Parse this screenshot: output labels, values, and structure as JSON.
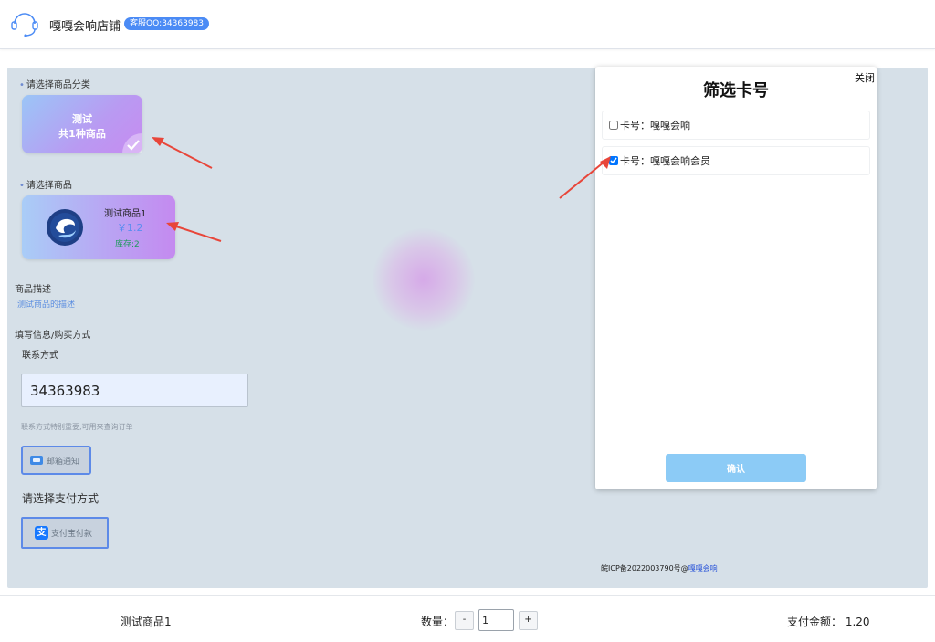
{
  "header": {
    "shop_name": "嘎嘎会响店铺",
    "qq_badge": "客服QQ:34363983"
  },
  "main": {
    "category_label": "请选择商品分类",
    "category_card": {
      "name": "测试",
      "count_text": "共1种商品"
    },
    "product_label": "请选择商品",
    "product_card": {
      "name": "测试商品1",
      "price": "￥1.2",
      "stock": "库存:2"
    },
    "description_title": "商品描述",
    "description_text": "测试商品的描述",
    "fill_title": "填写信息/购买方式",
    "contact_title": "联系方式",
    "contact_value": "34363983",
    "contact_tip": "联系方式特别重要,可用来查询订单",
    "email_button": "邮箱通知",
    "payment_title": "请选择支付方式",
    "alipay_button": "支付宝付款",
    "alipay_glyph": "支",
    "icp_text": "皖ICP备2022003790号@",
    "icp_link": "嘎嘎会响"
  },
  "modal": {
    "title": "筛选卡号",
    "close_label": "关闭",
    "options": [
      {
        "label": "卡号：嘎嘎会响",
        "checked": false
      },
      {
        "label": "卡号：嘎嘎会响会员",
        "checked": true
      }
    ],
    "confirm_label": "确认"
  },
  "footer": {
    "product_name": "测试商品1",
    "quantity_label": "数量：",
    "minus_label": "-",
    "quantity_value": "1",
    "plus_label": "+",
    "total_text": "支付金额： 1.20"
  },
  "colors": {
    "accent": "#4b8bf5",
    "panel_bg": "#d6e0e8",
    "confirm_bg": "#8ccbf6",
    "arrow": "#e8463a"
  }
}
